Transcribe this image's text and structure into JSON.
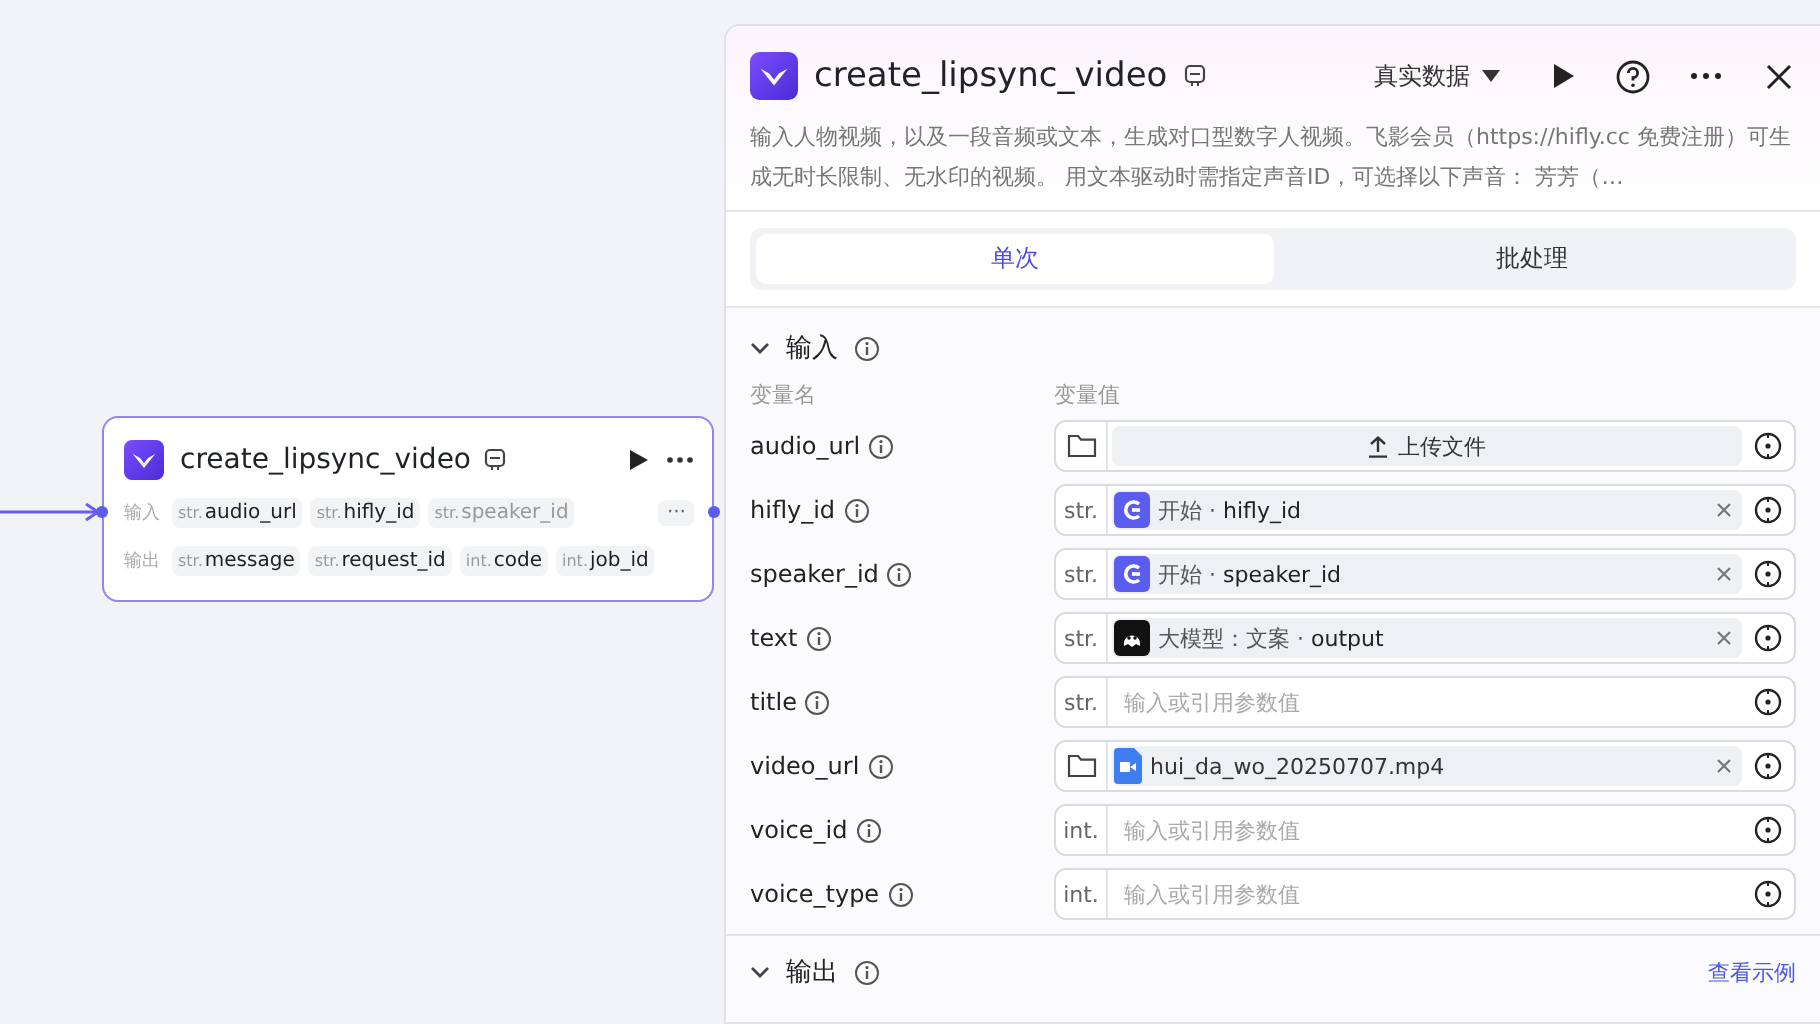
{
  "node": {
    "title": "create_lipsync_video",
    "input_label": "输入",
    "inputs": [
      {
        "type": "str.",
        "name": "audio_url",
        "faded": false
      },
      {
        "type": "str.",
        "name": "hifly_id",
        "faded": false
      },
      {
        "type": "str.",
        "name": "speaker_id",
        "faded": true
      }
    ],
    "more": "···",
    "output_label": "输出",
    "outputs": [
      {
        "type": "str.",
        "name": "message"
      },
      {
        "type": "str.",
        "name": "request_id"
      },
      {
        "type": "int.",
        "name": "code"
      },
      {
        "type": "int.",
        "name": "job_id"
      }
    ]
  },
  "panel": {
    "title": "create_lipsync_video",
    "data_mode": "真实数据",
    "description": "输入人物视频，以及一段音频或文本，生成对口型数字人视频。飞影会员（https://hifly.cc 免费注册）可生成无时长限制、无水印的视频。 用文本驱动时需指定声音ID，可选择以下声音： 芳芳（…",
    "tabs": [
      {
        "label": "单次",
        "selected": true
      },
      {
        "label": "批处理",
        "selected": false
      }
    ],
    "input_section": {
      "title": "输入",
      "expanded": true,
      "col_name": "变量名",
      "col_value": "变量值",
      "rows": [
        {
          "name": "audio_url",
          "kind": "upload",
          "label": "上传文件"
        },
        {
          "name": "hifly_id",
          "kind": "ref",
          "type": "str.",
          "source": {
            "kind": "start",
            "label": "开始 ·"
          },
          "variable": "hifly_id"
        },
        {
          "name": "speaker_id",
          "kind": "ref",
          "type": "str.",
          "source": {
            "kind": "start",
            "label": "开始 ·"
          },
          "variable": "speaker_id"
        },
        {
          "name": "text",
          "kind": "ref",
          "type": "str.",
          "source": {
            "kind": "llm",
            "label": "大模型：文案 ·"
          },
          "variable": "output"
        },
        {
          "name": "title",
          "kind": "empty",
          "type": "str.",
          "placeholder": "输入或引用参数值"
        },
        {
          "name": "video_url",
          "kind": "file",
          "filename": "hui_da_wo_20250707.mp4"
        },
        {
          "name": "voice_id",
          "kind": "empty",
          "type": "int.",
          "placeholder": "输入或引用参数值"
        },
        {
          "name": "voice_type",
          "kind": "empty",
          "type": "int.",
          "placeholder": "输入或引用参数值"
        }
      ]
    },
    "output_section": {
      "title": "输出",
      "expanded": true,
      "link": "查看示例"
    }
  }
}
